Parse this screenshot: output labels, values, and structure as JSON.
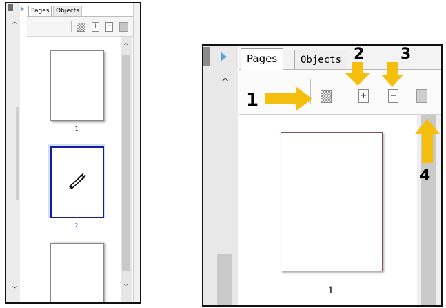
{
  "left_panel": {
    "tabs": [
      "Pages",
      "Objects"
    ],
    "pages": [
      {
        "number": "1",
        "selected": false,
        "content": "blank"
      },
      {
        "number": "2",
        "selected": true,
        "content": "pen-drawing"
      },
      {
        "number": "",
        "selected": false,
        "content": "blank"
      }
    ],
    "toolbar_icons": [
      "checkerboard-icon",
      "insert-page-icon",
      "delete-page-icon",
      "page-settings-icon"
    ],
    "colors": {
      "selection": "#1a1aa8",
      "selection_bg": "#cfe3f7",
      "page_label_selected": "#2a55c7"
    }
  },
  "right_panel": {
    "tabs": [
      "Pages",
      "Objects"
    ],
    "pages": [
      {
        "number": "1"
      }
    ],
    "toolbar_icons": [
      "checkerboard-icon",
      "insert-page-icon",
      "delete-page-icon",
      "page-settings-icon"
    ],
    "callouts": [
      "1",
      "2",
      "3",
      "4"
    ],
    "colors": {
      "arrow": "#f5bd0c"
    }
  }
}
